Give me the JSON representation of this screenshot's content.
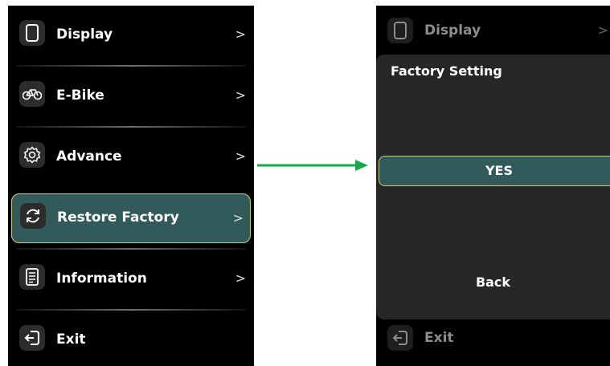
{
  "left_screen": {
    "menu": [
      {
        "label": "Display",
        "icon": "phone-icon",
        "chevron": ">"
      },
      {
        "label": "E-Bike",
        "icon": "bicycle-icon",
        "chevron": ">"
      },
      {
        "label": "Advance",
        "icon": "gear-icon",
        "chevron": ">"
      },
      {
        "label": "Restore Factory",
        "icon": "refresh-icon",
        "chevron": ">",
        "selected": true
      },
      {
        "label": "Information",
        "icon": "document-icon",
        "chevron": ">"
      },
      {
        "label": "Exit",
        "icon": "exit-icon"
      }
    ]
  },
  "right_screen": {
    "background_item": {
      "label": "Display",
      "icon": "phone-icon",
      "chevron": ">"
    },
    "dialog": {
      "title": "Factory Setting",
      "yes_label": "YES",
      "back_label": "Back"
    },
    "exit_item": {
      "label": "Exit",
      "icon": "exit-icon"
    }
  },
  "colors": {
    "selected_bg": "#335a5b",
    "selected_border": "#c9d36b",
    "arrow": "#17a84b",
    "dialog_bg": "#272727"
  }
}
